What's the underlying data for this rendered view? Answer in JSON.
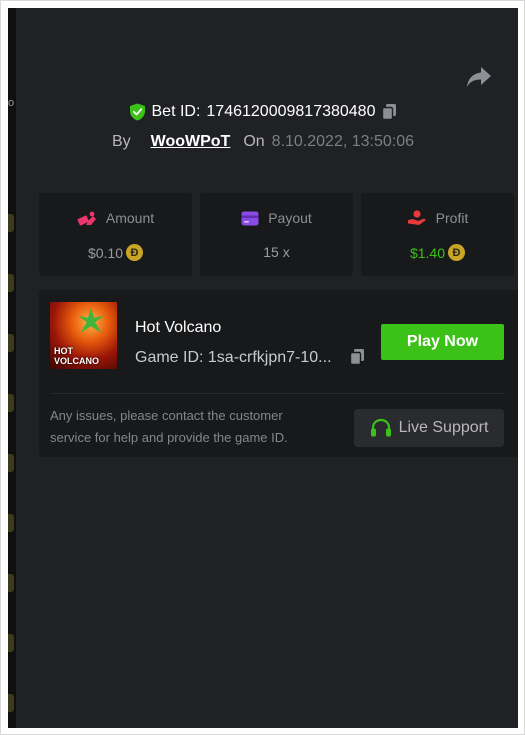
{
  "bet": {
    "id_label": "Bet ID:",
    "id_value": "1746120009817380480",
    "by_label": "By",
    "username": "WooWPoT",
    "on_label": "On",
    "date": "8.10.2022, 13:50:06"
  },
  "stats": [
    {
      "label": "Amount",
      "value": "$0.10",
      "icon": "bet-amount-icon",
      "coin": "Ð"
    },
    {
      "label": "Payout",
      "value": "15 x",
      "icon": "payout-card-icon"
    },
    {
      "label": "Profit",
      "value": "$1.40",
      "icon": "profit-hand-icon",
      "coin": "Ð"
    }
  ],
  "game": {
    "title": "Hot Volcano",
    "thumb_line1": "HOT",
    "thumb_line2": "VOLCANO",
    "id_text": "Game ID: 1sa-crfkjpn7-10...",
    "play_label": "Play Now",
    "issues_text": "Any issues, please contact the customer service for help and provide the game ID.",
    "support_label": "Live Support"
  },
  "sidebar_fragment": "o",
  "colors": {
    "background": "#202124",
    "card": "#18191b",
    "accent_green": "#3bc117",
    "profit_green": "#3bc117",
    "coin_gold": "#c9a526",
    "amount_pink": "#e9366f",
    "payout_purple": "#8a4be8",
    "profit_red": "#e8393b"
  }
}
